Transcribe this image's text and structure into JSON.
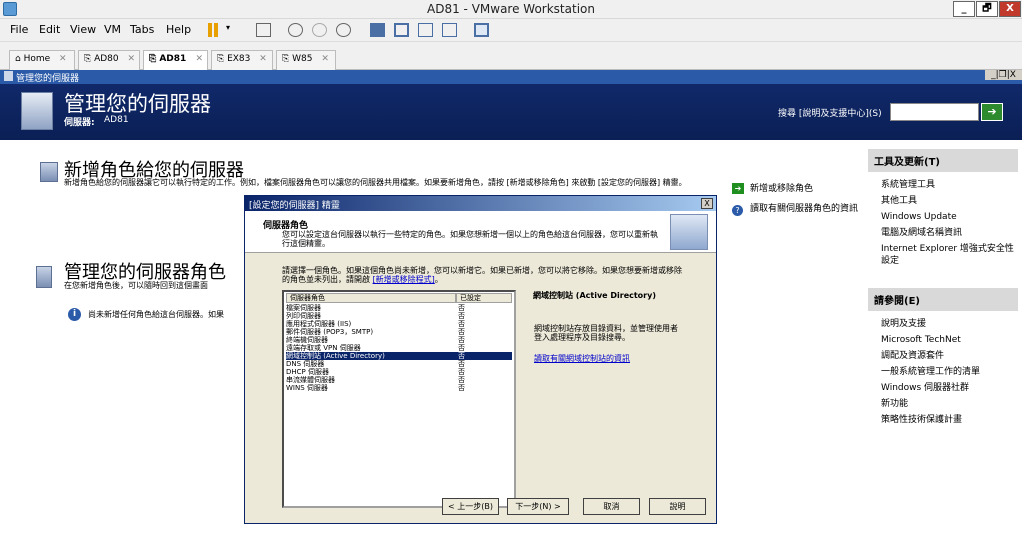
{
  "window": {
    "title": "AD81 - VMware Workstation",
    "minimize": "_",
    "maximize": "🗗",
    "close": "X"
  },
  "menu": [
    "File",
    "Edit",
    "View",
    "VM",
    "Tabs",
    "Help"
  ],
  "tabs": [
    {
      "label": "Home"
    },
    {
      "label": "AD80"
    },
    {
      "label": "AD81",
      "active": true
    },
    {
      "label": "EX83"
    },
    {
      "label": "W85"
    }
  ],
  "tab_close": "✕",
  "guest_window": {
    "title": "管理您的伺服器",
    "controls": "_|❐|X"
  },
  "banner": {
    "title": "管理您的伺服器",
    "server_label": "伺服器:",
    "server_name": "AD81",
    "search_label": "搜尋 [說明及支援中心](S)",
    "search_value": ""
  },
  "add_roles": {
    "title": "新增角色給您的伺服器",
    "desc": "新增角色給您的伺服器讓它可以執行特定的工作。例如，檔案伺服器角色可以讓您的伺服器共用檔案。如果要新增角色，請按 [新增或移除角色] 來啟動 [設定您的伺服器] 精靈。"
  },
  "manage_roles": {
    "title": "管理您的伺服器角色",
    "desc": "在您新增角色後，可以隨時回到這個畫面",
    "info": "尚未新增任何角色給這台伺服器。如果"
  },
  "actions": {
    "add_remove": "新增或移除角色",
    "read_more": "讀取有關伺服器角色的資訊"
  },
  "dialog": {
    "title": "[設定您的伺服器] 精靈",
    "close": "X",
    "head_title": "伺服器角色",
    "head_desc": "您可以設定這台伺服器以執行一些特定的角色。如果您想新增一個以上的角色給這台伺服器，您可以重新執行這個精靈。",
    "instr": "請選擇一個角色。如果這個角色尚未新增，您可以新增它。如果已新增，您可以將它移除。如果您想要新增或移除的角色並未列出，請開啟",
    "instr_link": "[新增或移除程式]",
    "instr_end": "。",
    "col_role": "伺服器角色",
    "col_status": "已設定",
    "roles": [
      {
        "name": "檔案伺服器",
        "status": "否"
      },
      {
        "name": "列印伺服器",
        "status": "否"
      },
      {
        "name": "應用程式伺服器 (IIS)",
        "status": "否"
      },
      {
        "name": "郵件伺服器 (POP3，SMTP)",
        "status": "否"
      },
      {
        "name": "終端機伺服器",
        "status": "否"
      },
      {
        "name": "遠端存取或 VPN 伺服器",
        "status": "否"
      },
      {
        "name": "網域控制站 (Active Directory)",
        "status": "否",
        "selected": true
      },
      {
        "name": "DNS 伺服器",
        "status": "否"
      },
      {
        "name": "DHCP 伺服器",
        "status": "否"
      },
      {
        "name": "串流媒體伺服器",
        "status": "否"
      },
      {
        "name": "WINS 伺服器",
        "status": "否"
      }
    ],
    "detail_title": "網域控制站 (Active Directory)",
    "detail_desc": "網域控制站存放目錄資料，並管理使用者登入處理程序及目錄搜尋。",
    "detail_link": "讀取有關網域控制站的資訊",
    "btn_back": "< 上一步(B)",
    "btn_next": "下一步(N) >",
    "btn_cancel": "取消",
    "btn_help": "說明"
  },
  "tools": {
    "title": "工具及更新(T)",
    "items": [
      "系統管理工具",
      "其他工具",
      "Windows Update",
      "電腦及網域名稱資訊",
      "Internet Explorer 增強式安全性設定"
    ]
  },
  "see_also": {
    "title": "請參閱(E)",
    "items": [
      "說明及支援",
      "Microsoft TechNet",
      "調配及資源套件",
      "一般系統管理工作的清單",
      "Windows 伺服器社群",
      "新功能",
      "策略性技術保護計畫"
    ]
  },
  "colors": {
    "banner": "#0a1f55",
    "selection": "#0a246a",
    "link": "#0000cc",
    "green_arrow": "#1f8f1f"
  }
}
